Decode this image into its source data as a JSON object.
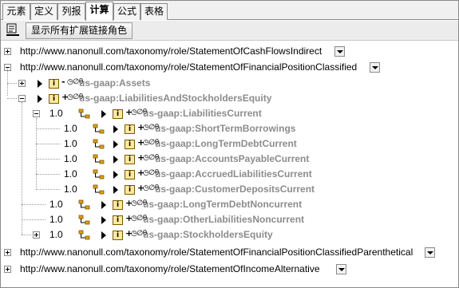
{
  "tabs": [
    {
      "label": "元素",
      "active": false
    },
    {
      "label": "定义",
      "active": false
    },
    {
      "label": "列报",
      "active": false
    },
    {
      "label": "计算",
      "active": true
    },
    {
      "label": "公式",
      "active": false
    },
    {
      "label": "表格",
      "active": false
    }
  ],
  "toolbar": {
    "icon": "display-roles-icon",
    "button_label": "显示所有扩展链接角色"
  },
  "roles": [
    {
      "url": "http://www.nanonull.com/taxonomy/role/StatementOfCashFlowsIndirect",
      "expanded": false
    },
    {
      "url": "http://www.nanonull.com/taxonomy/role/StatementOfFinancialPositionClassified",
      "expanded": true
    },
    {
      "url": "http://www.nanonull.com/taxonomy/role/StatementOfFinancialPositionClassifiedParenthetical",
      "expanded": false
    },
    {
      "url": "http://www.nanonull.com/taxonomy/role/StatementOfIncomeAlternative",
      "expanded": false
    }
  ],
  "nodes": {
    "assets": {
      "sign": "-",
      "name": "us-gaap:Assets",
      "attrs": "◷∅θ"
    },
    "liab_equity": {
      "sign": "+",
      "name": "us-gaap:LiabilitiesAndStockholdersEquity",
      "attrs": "◷∅θ"
    },
    "liab_current": {
      "order": "1.0",
      "sign": "+",
      "name": "us-gaap:LiabilitiesCurrent",
      "attrs": "◷∅θ"
    },
    "children": [
      {
        "order": "1.0",
        "sign": "+",
        "name": "us-gaap:ShortTermBorrowings",
        "attrs": "◷∅θ"
      },
      {
        "order": "1.0",
        "sign": "+",
        "name": "us-gaap:LongTermDebtCurrent",
        "attrs": "◷∅θ"
      },
      {
        "order": "1.0",
        "sign": "+",
        "name": "us-gaap:AccountsPayableCurrent",
        "attrs": "◷∅θ"
      },
      {
        "order": "1.0",
        "sign": "+",
        "name": "us-gaap:AccruedLiabilitiesCurrent",
        "attrs": "◷∅θ"
      },
      {
        "order": "1.0",
        "sign": "+",
        "name": "us-gaap:CustomerDepositsCurrent",
        "attrs": "◷∅θ"
      }
    ],
    "siblings": [
      {
        "order": "1.0",
        "sign": "+",
        "name": "us-gaap:LongTermDebtNoncurrent",
        "attrs": "◷∅θ"
      },
      {
        "order": "1.0",
        "sign": "+",
        "name": "us-gaap:OtherLiabilitiesNoncurrent",
        "attrs": "◷∅θ"
      },
      {
        "order": "1.0",
        "sign": "+",
        "name": "us-gaap:StockholdersEquity",
        "attrs": "◷∅θ"
      }
    ],
    "item_icon_letter": "i"
  },
  "colors": {
    "concept_text": "#8c8c8c",
    "item_icon_fill": "#ffe8a0",
    "link_icon": "#e0a000"
  }
}
